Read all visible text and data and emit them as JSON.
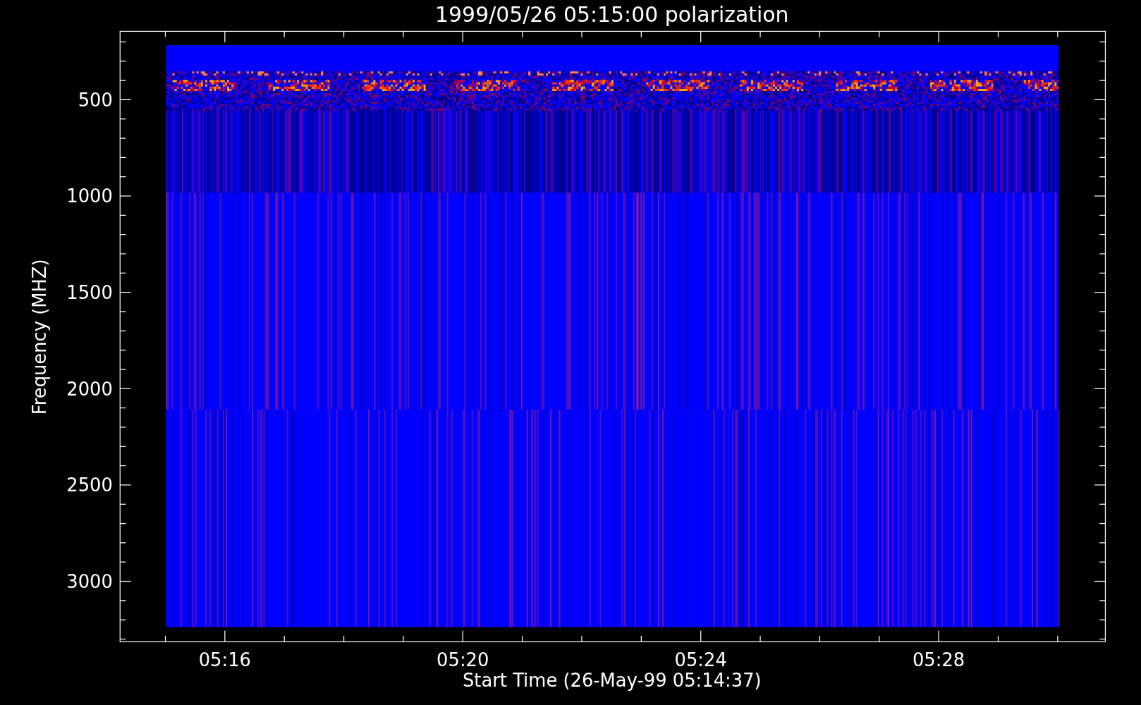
{
  "title": "1999/05/26 05:15:00 polarization",
  "y_axis": {
    "label": "Frequency (MHZ)",
    "ticks": [
      "500",
      "1000",
      "1500",
      "2000",
      "2500",
      "3000"
    ]
  },
  "x_axis": {
    "label": "Start Time (26-May-99 05:14:37)",
    "ticks": [
      "05:16",
      "05:20",
      "05:24",
      "05:28"
    ]
  }
}
